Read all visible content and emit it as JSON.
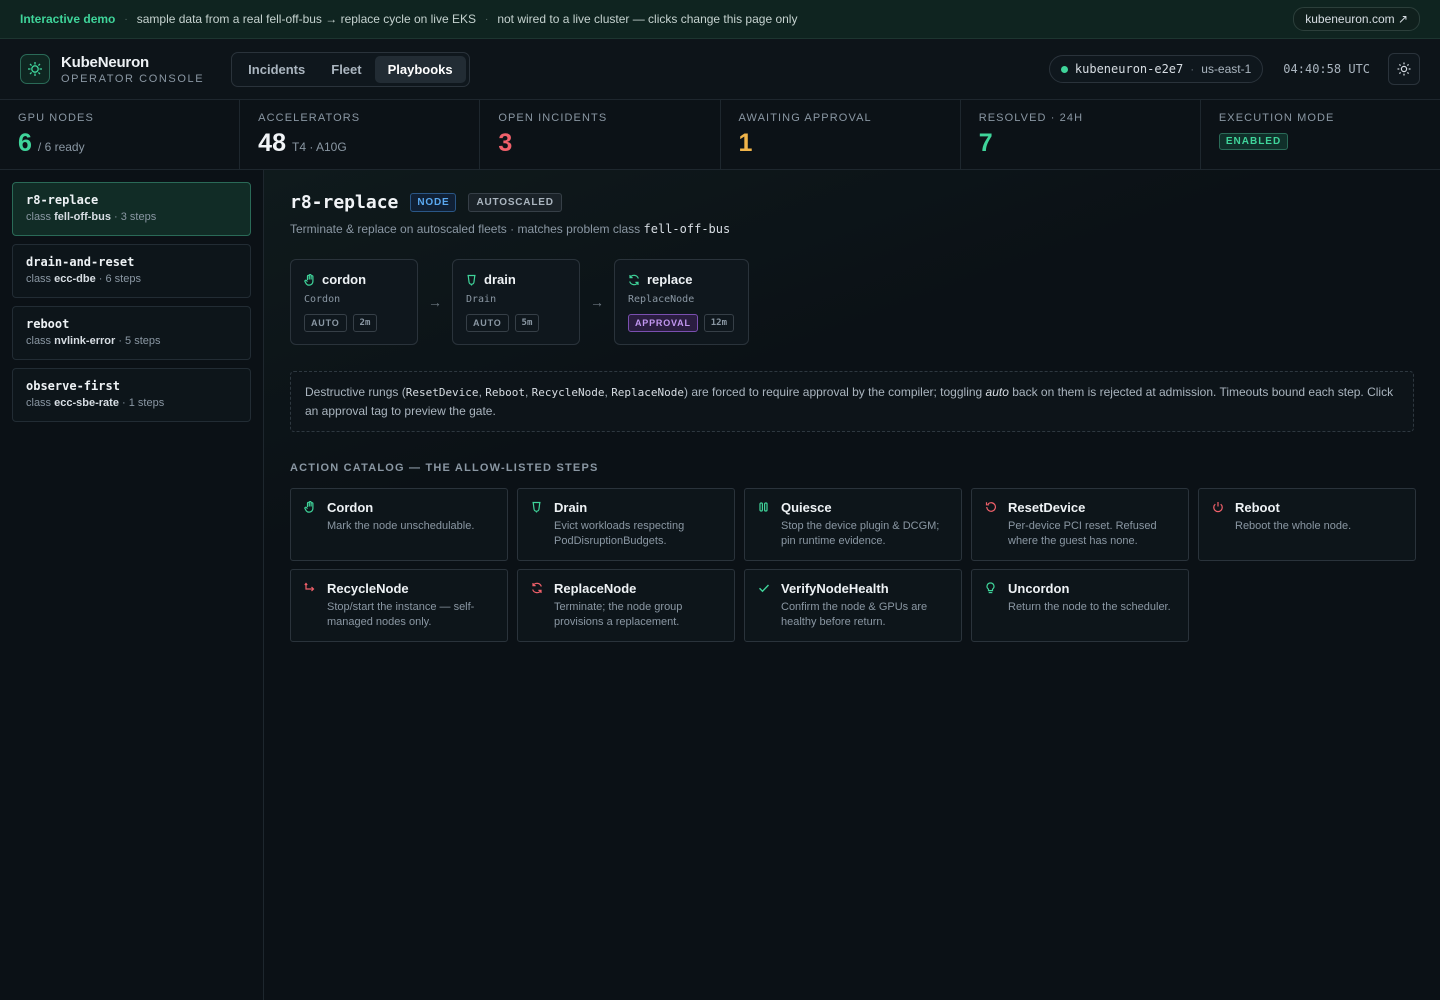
{
  "banner": {
    "demo_label": "Interactive demo",
    "sample_text": "sample data from a real fell-off-bus → replace cycle on live EKS",
    "notice_text": "not wired to a live cluster — clicks change this page only",
    "site_link": "kubeneuron.com ↗"
  },
  "header": {
    "brand_name": "KubeNeuron",
    "brand_sub": "OPERATOR CONSOLE",
    "tabs": [
      {
        "label": "Incidents",
        "active": false
      },
      {
        "label": "Fleet",
        "active": false
      },
      {
        "label": "Playbooks",
        "active": true
      }
    ],
    "cluster_name": "kubeneuron-e2e7",
    "cluster_region": "us-east-1",
    "clock": "04:40:58 UTC"
  },
  "stats": {
    "gpu_nodes": {
      "label": "GPU NODES",
      "value": "6",
      "sub": "/ 6 ready"
    },
    "accelerators": {
      "label": "ACCELERATORS",
      "value": "48",
      "sub": "T4 · A10G"
    },
    "open_incidents": {
      "label": "OPEN INCIDENTS",
      "value": "3"
    },
    "awaiting_approval": {
      "label": "AWAITING APPROVAL",
      "value": "1"
    },
    "resolved": {
      "label": "RESOLVED · 24H",
      "value": "7"
    },
    "execution_mode": {
      "label": "EXECUTION MODE",
      "value": "ENABLED"
    }
  },
  "playbooks": [
    {
      "name": "r8-replace",
      "class_prefix": "class",
      "class_name": "fell-off-bus",
      "steps": "· 3 steps",
      "active": true
    },
    {
      "name": "drain-and-reset",
      "class_prefix": "class",
      "class_name": "ecc-dbe",
      "steps": "· 6 steps",
      "active": false
    },
    {
      "name": "reboot",
      "class_prefix": "class",
      "class_name": "nvlink-error",
      "steps": "· 5 steps",
      "active": false
    },
    {
      "name": "observe-first",
      "class_prefix": "class",
      "class_name": "ecc-sbe-rate",
      "steps": "· 1 steps",
      "active": false
    }
  ],
  "detail": {
    "title": "r8-replace",
    "tag_node": "NODE",
    "tag_autoscaled": "AUTOSCALED",
    "desc_prefix": "Terminate & replace on autoscaled fleets · matches problem class",
    "desc_class": "fell-off-bus",
    "steps": [
      {
        "name": "cordon",
        "action": "Cordon",
        "mode": "AUTO",
        "timeout": "2m",
        "icon": "hand-icon"
      },
      {
        "name": "drain",
        "action": "Drain",
        "mode": "AUTO",
        "timeout": "5m",
        "icon": "cup-icon"
      },
      {
        "name": "replace",
        "action": "ReplaceNode",
        "mode": "APPROVAL",
        "timeout": "12m",
        "icon": "refresh-icon"
      }
    ],
    "step_arrow": "→",
    "note": {
      "t1": "Destructive rungs (",
      "c1": "ResetDevice",
      "t2": ", ",
      "c2": "Reboot",
      "t3": ", ",
      "c3": "RecycleNode",
      "t4": ", ",
      "c4": "ReplaceNode",
      "t5": ") are forced to require approval by the compiler; toggling ",
      "em": "auto",
      "t6": " back on them is rejected at admission. Timeouts bound each step. Click an approval tag to preview the gate."
    },
    "catalog_title": "ACTION CATALOG — THE ALLOW-LISTED STEPS",
    "catalog": [
      {
        "title": "Cordon",
        "desc": "Mark the node unschedulable.",
        "icon": "hand-icon",
        "color": "#3fd49a"
      },
      {
        "title": "Drain",
        "desc": "Evict workloads respecting PodDisruptionBudgets.",
        "icon": "cup-icon",
        "color": "#3fd49a"
      },
      {
        "title": "Quiesce",
        "desc": "Stop the device plugin & DCGM; pin runtime evidence.",
        "icon": "pause-icon",
        "color": "#3fd49a"
      },
      {
        "title": "ResetDevice",
        "desc": "Per-device PCI reset. Refused where the guest has none.",
        "icon": "rotate-ccw-icon",
        "color": "#f0606a"
      },
      {
        "title": "Reboot",
        "desc": "Reboot the whole node.",
        "icon": "power-icon",
        "color": "#f0606a"
      },
      {
        "title": "RecycleNode",
        "desc": "Stop/start the instance — self-managed nodes only.",
        "icon": "corner-arrow-icon",
        "color": "#f0606a"
      },
      {
        "title": "ReplaceNode",
        "desc": "Terminate; the node group provisions a replacement.",
        "icon": "refresh-icon",
        "color": "#f0606a"
      },
      {
        "title": "VerifyNodeHealth",
        "desc": "Confirm the node & GPUs are healthy before return.",
        "icon": "check-icon",
        "color": "#3fd49a"
      },
      {
        "title": "Uncordon",
        "desc": "Return the node to the scheduler.",
        "icon": "bulb-icon",
        "color": "#3fd49a"
      }
    ]
  }
}
